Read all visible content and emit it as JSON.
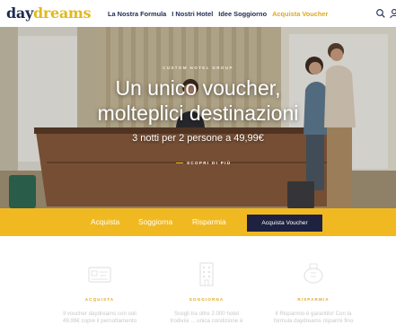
{
  "header": {
    "logo_part1": "day",
    "logo_part2": "dreams",
    "nav": [
      "La Nostra Formula",
      "I Nostri Hotel",
      "Idee Soggiorno",
      "Acquista Voucher"
    ]
  },
  "hero": {
    "kicker": "CUSTOM HOTEL GROUP",
    "title_line1": "Un unico voucher,",
    "title_line2": "molteplici destinazioni",
    "subtitle": "3 notti per 2 persone a 49,99€",
    "cta": "SCOPRI DI PIÙ"
  },
  "bar": {
    "links": [
      "Acquista",
      "Soggiorna",
      "Risparmia"
    ],
    "button": "Acquista Voucher"
  },
  "features": [
    {
      "icon": "voucher-card-icon",
      "title": "ACQUISTA",
      "text": "Il voucher daydreams con soli\n49,99€ copre il pernottamento"
    },
    {
      "icon": "hotel-building-icon",
      "title": "SOGGIORNA",
      "text": "Scegli tra oltre 2.000 hotel\ntrodivisi ... unica condizione è"
    },
    {
      "icon": "piggy-bank-icon",
      "title": "RISPARMIA",
      "text": "Il Risparmio è garantito! Con la\nformula daydreams risparmi fino"
    }
  ],
  "colors": {
    "navy": "#1e2a50",
    "gold": "#e3b91c",
    "bar_yellow": "#f0b921",
    "button_dark": "#1e2240"
  }
}
